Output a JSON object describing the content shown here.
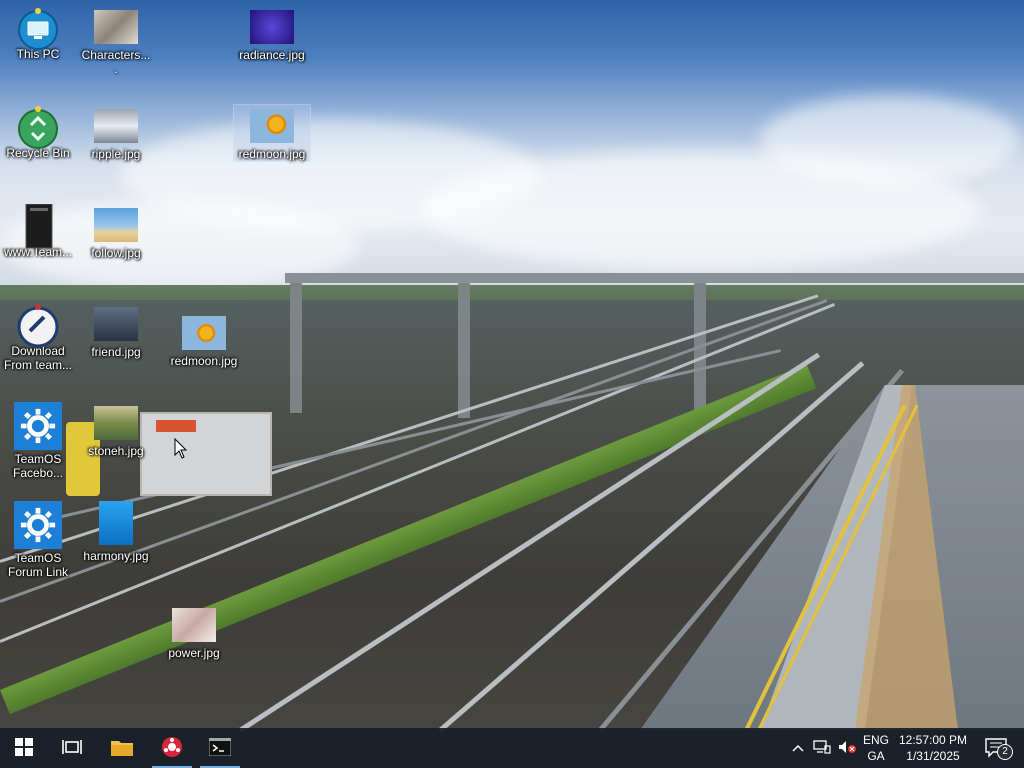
{
  "desktop": {
    "icons": [
      {
        "label": "This PC",
        "icon": "this-pc-icon"
      },
      {
        "label": "Characters....",
        "icon": "image-file-icon"
      },
      {
        "label": "radiance.jpg",
        "icon": "image-file-icon"
      },
      {
        "label": "Recycle Bin",
        "icon": "recycle-bin-icon"
      },
      {
        "label": "ripple.jpg",
        "icon": "image-file-icon"
      },
      {
        "label": "redmoon.jpg",
        "icon": "image-file-icon"
      },
      {
        "label": "www.Team...",
        "icon": "book-icon"
      },
      {
        "label": "follow.jpg",
        "icon": "image-file-icon"
      },
      {
        "label": "Download From team...",
        "icon": "download-shortcut-icon"
      },
      {
        "label": "friend.jpg",
        "icon": "image-file-icon"
      },
      {
        "label": "redmoon.jpg",
        "icon": "image-file-icon"
      },
      {
        "label": "TeamOS Facebo...",
        "icon": "gear-icon"
      },
      {
        "label": "stoneh.jpg",
        "icon": "image-file-icon"
      },
      {
        "label": "TeamOS Forum Link",
        "icon": "gear-icon"
      },
      {
        "label": "harmony.jpg",
        "icon": "image-file-icon"
      },
      {
        "label": "power.jpg",
        "icon": "image-file-icon"
      }
    ]
  },
  "taskbar": {
    "start": "windows-start-icon",
    "task_view": "task-view-icon",
    "pinned": [
      "file-explorer-icon",
      "app-icon",
      "command-prompt-icon"
    ],
    "tray": {
      "language_top": "ENG",
      "language_bottom": "GA",
      "time": "12:57:00 PM",
      "date": "1/31/2025",
      "notification_count": "2"
    }
  },
  "colors": {
    "accent": "#1e7fd6",
    "taskbar_bg": "#181e26",
    "active_indicator": "#78aee0"
  }
}
